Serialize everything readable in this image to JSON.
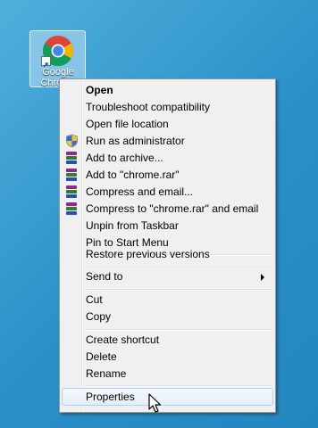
{
  "desktop_icon": {
    "label": "Google Chrome",
    "icon": "chrome-shortcut-icon"
  },
  "context_menu": {
    "items": [
      {
        "label": "Open",
        "bold": true
      },
      {
        "label": "Troubleshoot compatibility"
      },
      {
        "label": "Open file location"
      },
      {
        "label": "Run as administrator",
        "icon": "uac-shield-icon"
      },
      {
        "label": "Add to archive...",
        "icon": "winrar-icon"
      },
      {
        "label": "Add to \"chrome.rar\"",
        "icon": "winrar-icon"
      },
      {
        "label": "Compress and email...",
        "icon": "winrar-icon"
      },
      {
        "label": "Compress to \"chrome.rar\" and email",
        "icon": "winrar-icon"
      },
      {
        "label": "Unpin from Taskbar"
      },
      {
        "label": "Pin to Start Menu"
      },
      {
        "label": "Restore previous versions"
      },
      {
        "label": "Send to",
        "submenu": true
      },
      {
        "label": "Cut"
      },
      {
        "label": "Copy"
      },
      {
        "label": "Create shortcut"
      },
      {
        "label": "Delete"
      },
      {
        "label": "Rename"
      },
      {
        "label": "Properties",
        "hovered": true
      }
    ]
  },
  "colors": {
    "desktop_top": "#4fb0dd",
    "desktop_bottom": "#2486c0",
    "menu_background": "#f0f0f0",
    "highlight_border": "#aecff7"
  }
}
